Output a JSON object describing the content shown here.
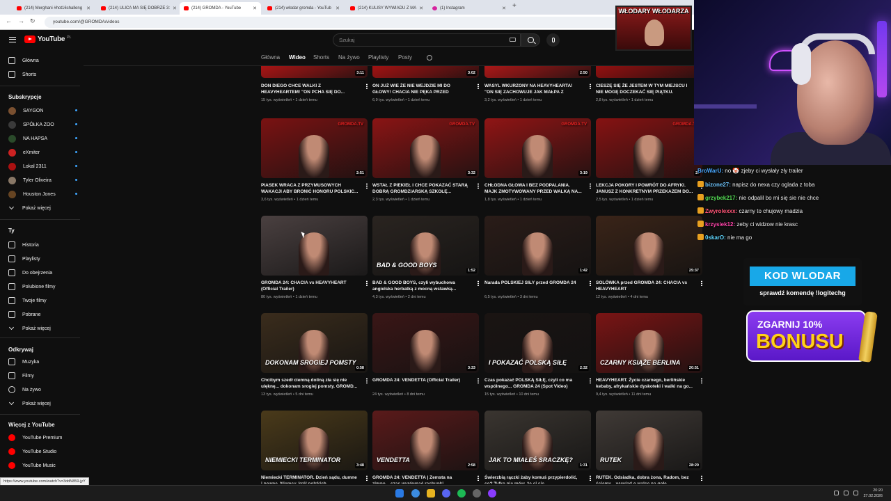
{
  "browser": {
    "tabs": [
      {
        "title": "(214) Merghani #hot16challeng",
        "icon": "youtube"
      },
      {
        "title": "(214) ULICA MA SIĘ DOBRZE 3:",
        "icon": "youtube"
      },
      {
        "title": "(214) GROMDA - YouTube",
        "icon": "youtube",
        "active": true
      },
      {
        "title": "(214) wlodar gromda - YouTub",
        "icon": "youtube"
      },
      {
        "title": "(214) KULISY WYWIADU Z MA",
        "icon": "youtube"
      },
      {
        "title": "(1) Instagram",
        "icon": "instagram"
      }
    ],
    "url": "youtube.com/@GROMDA/videos"
  },
  "youtube": {
    "logo": "YouTube",
    "country": "PL",
    "search_placeholder": "Szukaj"
  },
  "sidebar": {
    "main": [
      "Główna",
      "Shorts"
    ],
    "subs_header": "Subskrypcje",
    "subscriptions": [
      {
        "name": "SAYGON",
        "color": "#7a5030"
      },
      {
        "name": "SPÓŁKA ZOO",
        "color": "#3a3a3a"
      },
      {
        "name": "NA HAPSA",
        "color": "#2a4a2a"
      },
      {
        "name": "eXmiter",
        "color": "#cc2222"
      },
      {
        "name": "Lokal 2311",
        "color": "#aa1111"
      },
      {
        "name": "Tyler Oliveira",
        "color": "#887766"
      },
      {
        "name": "Houston Jones",
        "color": "#664422"
      }
    ],
    "subs_more": "Pokaż więcej",
    "you_header": "Ty",
    "you_items": [
      "Historia",
      "Playlisty",
      "Do obejrzenia",
      "Polubione filmy",
      "Twoje filmy",
      "Pobrane",
      "Pokaż więcej"
    ],
    "explore_header": "Odkrywaj",
    "explore_items": [
      "Muzyka",
      "Filmy",
      "Na żywo",
      "Pokaż więcej"
    ],
    "more_header": "Więcej z YouTube",
    "more_items": [
      "YouTube Premium",
      "YouTube Studio",
      "YouTube Music"
    ]
  },
  "channel_tabs": [
    "Główna",
    "Wideo",
    "Shorts",
    "Na żywo",
    "Playlisty",
    "Posty"
  ],
  "videos": [
    {
      "title": "DON DIEGO CHCE WALKI Z HEAVYHEARTEM! \"ON PCHA SIĘ DO...",
      "views": "15 tys. wyświetleń",
      "age": "1 dzień temu",
      "duration": "3:11",
      "bg": "#b01515"
    },
    {
      "title": "ON JUŻ WIE ŻE NIE WEJDZIE MI DO GŁOWY! CHACIA NIE PĘKA PRZED HEAVYHEARTE...",
      "views": "6,9 tys. wyświetleń",
      "age": "1 dzień temu",
      "duration": "3:02",
      "bg": "#a81212"
    },
    {
      "title": "WASYL WKURZONY NA HEAVYHEARTA! \"ON SIĘ ZACHOWUJE JAK MAŁPA Z DRZEWA...",
      "views": "3,2 tys. wyświetleń",
      "age": "1 dzień temu",
      "duration": "2:50",
      "bg": "#b21818"
    },
    {
      "title": "CIESZĘ SIĘ ŻE JESTEM W TYM MIEJSCU I NIE MOGĘ DOCZEKAĆ SIĘ PIĄTKU. RUTEK...",
      "views": "2,8 tys. wyświetleń",
      "age": "1 dzień temu",
      "duration": "3:",
      "bg": "#9a1010"
    },
    {
      "title": "PIASEK WRACA Z PRZYMUSOWYCH WAKACJI ABY BRONIĆ HONORU POLSKIC...",
      "views": "3,6 tys. wyświetleń",
      "age": "1 dzień temu",
      "duration": "2:51",
      "bg": "#7a1212",
      "overlay": "GROMDA.TV"
    },
    {
      "title": "WSTAŁ Z PIEKIEŁ I CHCE POKAZAĆ STARĄ DOBRĄ GROMDZIARSKĄ SZKOŁĘ...",
      "views": "2,3 tys. wyświetleń",
      "age": "1 dzień temu",
      "duration": "3:32",
      "bg": "#8a1414",
      "overlay": "GROMDA.TV"
    },
    {
      "title": "CHŁODNA GŁOWA I BEZ PODPALANIA. MAJK ZMOTYWOWANY PRZED WALKĄ NA...",
      "views": "1,8 tys. wyświetleń",
      "age": "1 dzień temu",
      "duration": "3:19",
      "bg": "#901515",
      "overlay": "GROMDA.TV"
    },
    {
      "title": "LEKCJA POKORY I POWRÓT DO AFRYKI. JANUSZ Z KONKRETNYM PRZEKAZEM DO...",
      "views": "2,5 tys. wyświetleń",
      "age": "1 dzień temu",
      "duration": "2:",
      "bg": "#861212",
      "overlay": "GROMDA.TV"
    },
    {
      "title": "GROMDA 24: CHACIA vs HEAVYHEART (Official Trailer)",
      "views": "80 tys. wyświetleń",
      "age": "1 dzień temu",
      "duration": "",
      "bg": "#4a4040"
    },
    {
      "title": "BAD & GOOD BOYS, czyli wybuchowa angielska herbatką z mocną wstawką...",
      "views": "4,3 tys. wyświetleń",
      "age": "2 dni temu",
      "duration": "1:52",
      "bg": "#2a2420",
      "overlay": "BAD & GOOD BOYS"
    },
    {
      "title": "Narada POLSKIEJ SIŁY przed GROMDA 24",
      "views": "6,5 tys. wyświetleń",
      "age": "3 dni temu",
      "duration": "1:42",
      "bg": "#2a1c18"
    },
    {
      "title": "SOLÓWKA przed GROMDA 24: CHACIA vs HEAVYHEART",
      "views": "12 tys. wyświetleń",
      "age": "4 dni temu",
      "duration": "25:37",
      "bg": "#3a2418"
    },
    {
      "title": "Chcibym szedł ciemną doliną zła się nie ulęknę... dokonam srogiej pomsty. GROMD...",
      "views": "13 tys. wyświetleń",
      "age": "5 dni temu",
      "duration": "0:58",
      "bg": "#3a2c1c",
      "overlay": "DOKONAM SROGIEJ POMSTY"
    },
    {
      "title": "GROMDA 24: VENDETTA (Official Trailer)",
      "views": "24 tys. wyświetleń",
      "age": "8 dni temu",
      "duration": "3:33",
      "bg": "#3a1616"
    },
    {
      "title": "Czas pokazać POLSKĄ SIŁĘ, czyli co ma wspólnego... GROMDA 24 (Spot Video)",
      "views": "15 tys. wyświetleń",
      "age": "10 dni temu",
      "duration": "2:32",
      "bg": "#1a1412",
      "overlay": "I POKAZAĆ POLSKĄ SIŁĘ"
    },
    {
      "title": "HEAVYHEART. Życie czarnego, berlińskie kebaby, afrykańskie dyskoteki i walki na go...",
      "views": "9,4 tys. wyświetleń",
      "age": "11 dni temu",
      "duration": "20:51",
      "bg": "#7a1414",
      "overlay": "CZARNY KSIĄŻE BERLINA"
    },
    {
      "title": "Niemiecki TERMINATOR. Dzień sądu, dumne i pewne. Niemcy, król polskich...",
      "views": "",
      "age": "",
      "duration": "3:48",
      "bg": "#4a3a1a",
      "overlay": "NIEMIECKI TERMINATOR"
    },
    {
      "title": "GROMDA 24: VENDETTA | Zemsta na zimno... czas wyrównać rachunki...",
      "views": "",
      "age": "",
      "duration": "2:58",
      "bg": "#5a1a1a",
      "overlay": "VENDETTA"
    },
    {
      "title": "Świerzbią rączki żaby komuś przypierdolić, co? Tylko nie mów, że ci się...",
      "views": "",
      "age": "",
      "duration": "1:31",
      "bg": "#3a3530",
      "overlay": "JAK TO MIAŁEŚ SRACZKĘ?"
    },
    {
      "title": "RUTEK. Odsiadka, dobra żona, Radom, bez ściemy... wywiad o walce na gołe...",
      "views": "",
      "age": "",
      "duration": "28:20",
      "bg": "#403a36",
      "overlay": "RUTEK"
    }
  ],
  "status_url": "https://www.youtube.com/watch?v=3ddN859-jyY",
  "taskbar": {
    "time": "20:20",
    "date": "27.02.2026"
  },
  "stream": {
    "banner": "WŁODARY WŁODARZA",
    "chat": [
      {
        "user": "BroWarU:",
        "text": "no 🤡 zjeby ci wysłały zły trailer",
        "color": "#4aa8ff"
      },
      {
        "user": "bizone27:",
        "text": "napisz do nexa czy oglada z toba",
        "color": "#6ec6ff"
      },
      {
        "user": "grzybek217:",
        "text": "nie odpalil bo mi się sie nie chce",
        "color": "#55dd55"
      },
      {
        "user": "Zwyrolexxx:",
        "text": "czarny to chujowy madzia",
        "color": "#ff5577"
      },
      {
        "user": "krzysiek12:",
        "text": "zeby ci widzow nie krasc",
        "color": "#ff44aa"
      },
      {
        "user": "0skarO:",
        "text": "nie ma go",
        "color": "#5fd7ff"
      }
    ],
    "promo_code": "KOD WLODAR",
    "promo_sub": "sprawdź komendę !logitechg",
    "bonus_line1": "ZGARNIJ 10%",
    "bonus_line2": "BONUSU"
  }
}
